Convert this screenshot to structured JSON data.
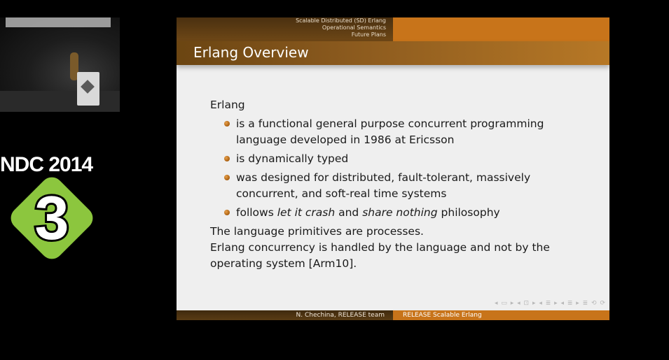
{
  "slide": {
    "header": {
      "sections": [
        "Scalable Distributed (SD) Erlang",
        "Operational Semantics",
        "Future Plans"
      ]
    },
    "title": "Erlang Overview",
    "body": {
      "lead": "Erlang",
      "bullets": [
        {
          "plain": "is a functional general purpose concurrent programming language developed in 1986 at Ericsson"
        },
        {
          "plain": "is dynamically typed"
        },
        {
          "plain": "was designed for distributed, fault-tolerant, massively concurrent, and soft-real time systems"
        },
        {
          "pre": "follows ",
          "em1": "let it crash",
          "mid": " and ",
          "em2": "share nothing",
          "post": " philosophy"
        }
      ],
      "para1": "The language primitives are processes.",
      "para2": "Erlang concurrency is handled by the language and not by the operating system [Arm10]."
    },
    "nav_symbols": "◂ ▭ ▸ ◂ ⊡ ▸ ◂ ≣ ▸ ◂ ≣ ▸ ≣ ⟲ ⟳",
    "footer": {
      "author": "N. Chechina, RELEASE team",
      "title": "RELEASE Scalable Erlang"
    }
  },
  "conference": {
    "name": "NDC 2014",
    "room": "3",
    "badge_color": "#8cc63e"
  },
  "theme": {
    "accent_orange": "#c8741a",
    "title_bar_brown": "#6b4512",
    "bullet_orange": "#d68a30"
  }
}
